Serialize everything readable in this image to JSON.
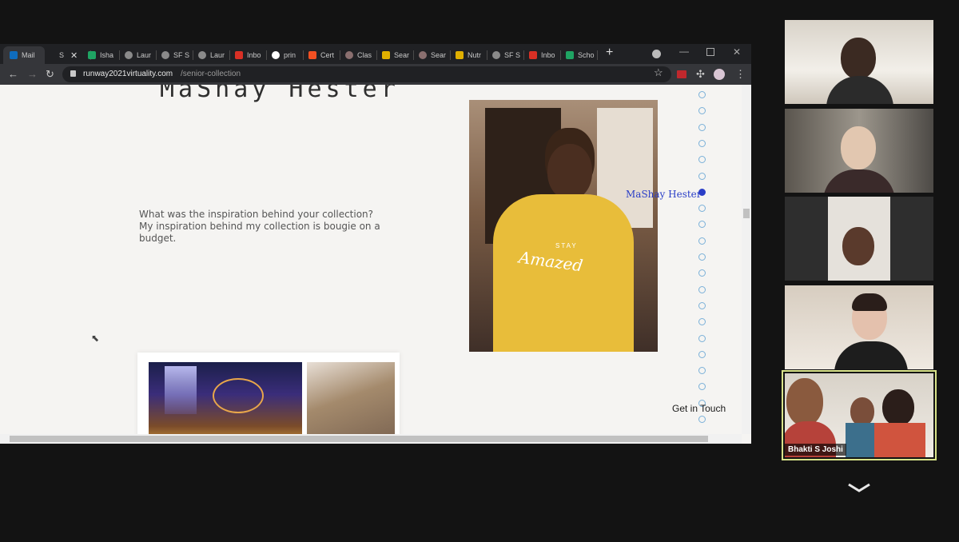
{
  "browser": {
    "tabs": [
      {
        "label": "Mail",
        "color": "#0f6cbd"
      },
      {
        "label": "S",
        "color": "#35363a"
      },
      {
        "label": "Isha",
        "color": "#1fa463"
      },
      {
        "label": "Laur",
        "color": "#8a8a8a"
      },
      {
        "label": "SF S",
        "color": "#8a8a8a"
      },
      {
        "label": "Laur",
        "color": "#8a8a8a"
      },
      {
        "label": "Inbo",
        "color": "#d93025"
      },
      {
        "label": "prin",
        "color": "#4285f4"
      },
      {
        "label": "Cert",
        "color": "#f25022"
      },
      {
        "label": "Clas",
        "color": "#8a6f6f"
      },
      {
        "label": "Sear",
        "color": "#e0b000"
      },
      {
        "label": "Sear",
        "color": "#8a6f6f"
      },
      {
        "label": "Nutr",
        "color": "#e0b000"
      },
      {
        "label": "SF S",
        "color": "#8a8a8a"
      },
      {
        "label": "Inbo",
        "color": "#d93025"
      },
      {
        "label": "Scho",
        "color": "#1fa463"
      }
    ],
    "new_tab": "+",
    "url_domain": "runway2021virtuality.com",
    "url_path": "/senior-collection"
  },
  "page": {
    "designer_name": "MaShay Hester",
    "question": "What was the inspiration behind your collection?",
    "answer": "My inspiration behind my collection is bougie on a budget.",
    "photo_shirt_text_1": "STAY",
    "photo_shirt_text_2": "Amazed",
    "nav_active_label": "MaShay Hester",
    "get_in_touch": "Get in Touch"
  },
  "participants": [
    {
      "name": ""
    },
    {
      "name": ""
    },
    {
      "name": ""
    },
    {
      "name": ""
    },
    {
      "name": "Bhakti S Joshi",
      "active_speaker": true
    }
  ],
  "colors": {
    "active_speaker_border": "#d9e38a",
    "nav_dot": "#7ab0d8",
    "nav_active": "#2a3ec7"
  }
}
